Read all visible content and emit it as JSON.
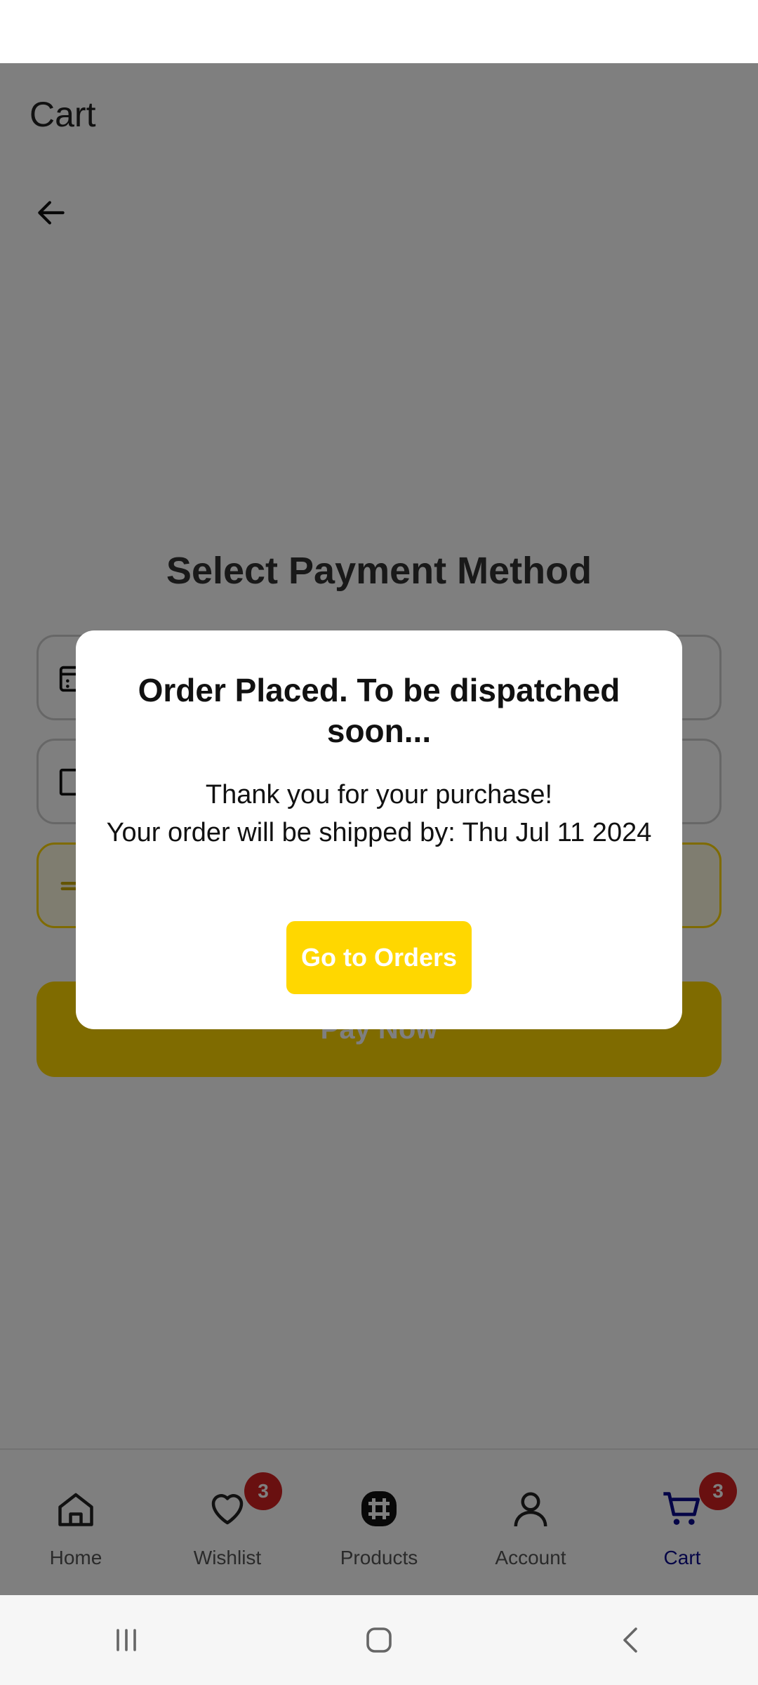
{
  "header": {
    "title": "Cart"
  },
  "payment": {
    "title": "Select Payment Method",
    "pay_now_label": "Pay Now"
  },
  "dialog": {
    "title": "Order Placed. To be dispatched soon...",
    "message_line1": "Thank you for your purchase!",
    "message_line2": "Your order will be shipped by: Thu Jul 11 2024",
    "button_label": "Go to Orders"
  },
  "nav": {
    "items": [
      {
        "label": "Home",
        "icon": "home-icon"
      },
      {
        "label": "Wishlist",
        "icon": "heart-icon",
        "badge": "3"
      },
      {
        "label": "Products",
        "icon": "products-icon"
      },
      {
        "label": "Account",
        "icon": "account-icon"
      },
      {
        "label": "Cart",
        "icon": "cart-icon",
        "badge": "3",
        "active": true
      }
    ]
  },
  "colors": {
    "accent": "#FFD700",
    "active_nav": "#0b0b8f",
    "badge": "#d32020"
  }
}
